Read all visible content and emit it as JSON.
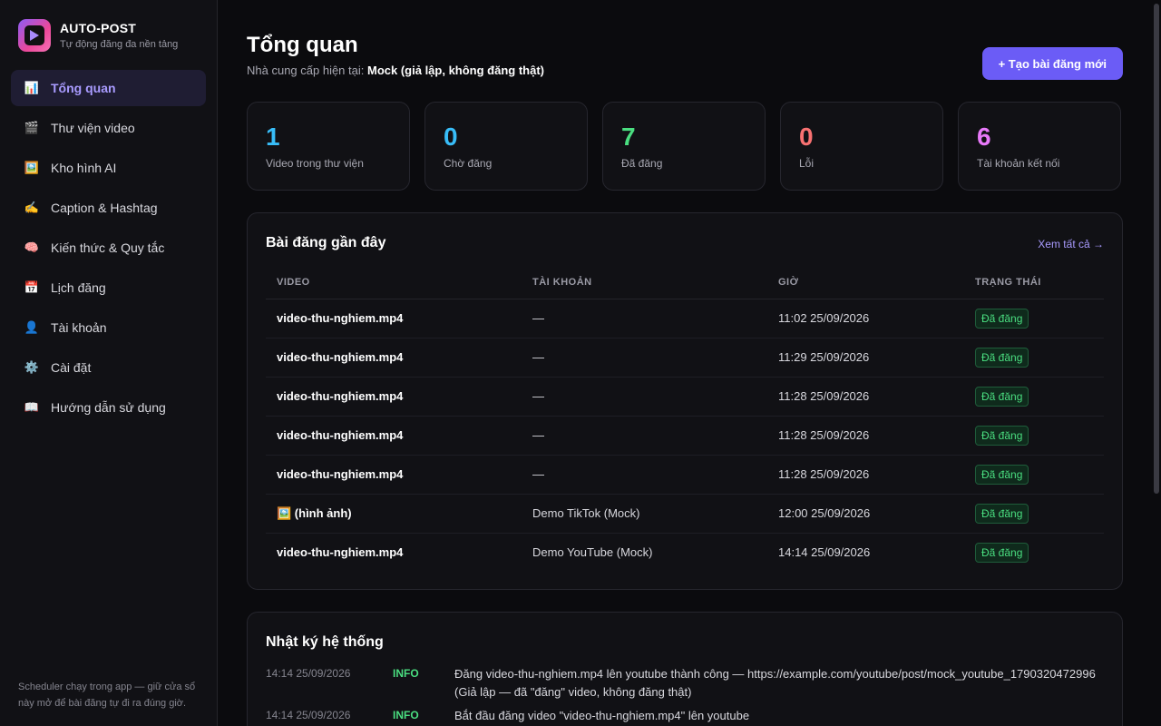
{
  "brand": {
    "title": "AUTO-POST",
    "subtitle": "Tự động đăng đa nền tảng"
  },
  "sidebar": {
    "items": [
      {
        "label": "Tổng quan",
        "icon": "bar-chart-icon",
        "glyph": "📊",
        "active": true
      },
      {
        "label": "Thư viện video",
        "icon": "clapperboard-icon",
        "glyph": "🎬"
      },
      {
        "label": "Kho hình AI",
        "icon": "picture-icon",
        "glyph": "🖼️"
      },
      {
        "label": "Caption & Hashtag",
        "icon": "writing-hand-icon",
        "glyph": "✍️"
      },
      {
        "label": "Kiến thức & Quy tắc",
        "icon": "brain-icon",
        "glyph": "🧠"
      },
      {
        "label": "Lịch đăng",
        "icon": "calendar-icon",
        "glyph": "📅"
      },
      {
        "label": "Tài khoản",
        "icon": "user-icon",
        "glyph": "👤"
      },
      {
        "label": "Cài đặt",
        "icon": "gear-icon",
        "glyph": "⚙️"
      },
      {
        "label": "Hướng dẫn sử dụng",
        "icon": "book-icon",
        "glyph": "📖"
      }
    ],
    "footer": "Scheduler chạy trong app — giữ cửa sổ này mở để bài đăng tự đi ra đúng giờ."
  },
  "header": {
    "title": "Tổng quan",
    "provider_prefix": "Nhà cung cấp hiện tại:",
    "provider_value": "Mock (giả lập, không đăng thật)",
    "new_post_label": "+ Tạo bài đăng mới"
  },
  "stats": [
    {
      "value": "1",
      "label": "Video trong thư viện",
      "color": "#38bdf8"
    },
    {
      "value": "0",
      "label": "Chờ đăng",
      "color": "#38bdf8"
    },
    {
      "value": "7",
      "label": "Đã đăng",
      "color": "#4ade80"
    },
    {
      "value": "0",
      "label": "Lỗi",
      "color": "#f87171"
    },
    {
      "value": "6",
      "label": "Tài khoản kết nối",
      "color": "#e879f9"
    }
  ],
  "recent": {
    "title": "Bài đăng gần đây",
    "see_all": "Xem tất cả →",
    "columns": [
      "VIDEO",
      "TÀI KHOẢN",
      "GIỜ",
      "TRẠNG THÁI"
    ],
    "rows": [
      {
        "video": "video-thu-nghiem.mp4",
        "account": "—",
        "time": "11:02 25/09/2026",
        "status": "Đã đăng"
      },
      {
        "video": "video-thu-nghiem.mp4",
        "account": "—",
        "time": "11:29 25/09/2026",
        "status": "Đã đăng"
      },
      {
        "video": "video-thu-nghiem.mp4",
        "account": "—",
        "time": "11:28 25/09/2026",
        "status": "Đã đăng"
      },
      {
        "video": "video-thu-nghiem.mp4",
        "account": "—",
        "time": "11:28 25/09/2026",
        "status": "Đã đăng"
      },
      {
        "video": "video-thu-nghiem.mp4",
        "account": "—",
        "time": "11:28 25/09/2026",
        "status": "Đã đăng"
      },
      {
        "video": "🖼️ (hình ảnh)",
        "account": "Demo TikTok (Mock)",
        "time": "12:00 25/09/2026",
        "status": "Đã đăng"
      },
      {
        "video": "video-thu-nghiem.mp4",
        "account": "Demo YouTube (Mock)",
        "time": "14:14 25/09/2026",
        "status": "Đã đăng"
      }
    ]
  },
  "log": {
    "title": "Nhật ký hệ thống",
    "entries": [
      {
        "time": "14:14 25/09/2026",
        "level": "INFO",
        "message": "Đăng video-thu-nghiem.mp4 lên youtube thành công — https://example.com/youtube/post/mock_youtube_1790320472996 (Giả lập — đã \"đăng\" video, không đăng thật)"
      },
      {
        "time": "14:14 25/09/2026",
        "level": "INFO",
        "message": "Bắt đầu đăng video \"video-thu-nghiem.mp4\" lên youtube"
      }
    ]
  }
}
